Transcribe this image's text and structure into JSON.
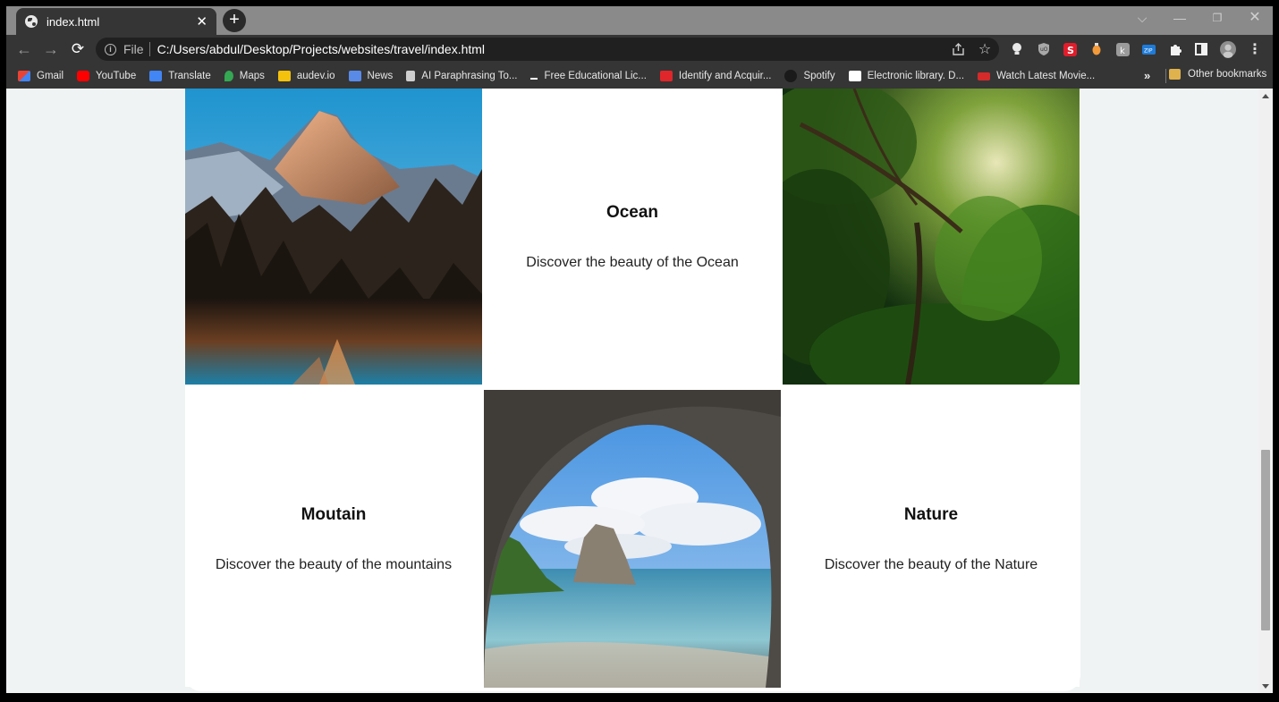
{
  "browser": {
    "tab_title": "index.html",
    "tab_close": "✕",
    "new_tab": "+",
    "window_controls": {
      "dropdown": "⌵",
      "minimize": "—",
      "restore": "❐",
      "close": "✕"
    },
    "nav": {
      "back": "←",
      "forward": "→",
      "reload": "⟳"
    },
    "address": {
      "scheme_label": "File",
      "url": "C:/Users/abdul/Desktop/Projects/websites/travel/index.html"
    },
    "bookmarks": [
      {
        "label": "Gmail",
        "color": "#ea4335"
      },
      {
        "label": "YouTube",
        "color": "#ff0000"
      },
      {
        "label": "Translate",
        "color": "#4285f4"
      },
      {
        "label": "Maps",
        "color": "#34a853"
      },
      {
        "label": "audev.io",
        "color": "#f4c20d"
      },
      {
        "label": "News",
        "color": "#5a8ae8"
      },
      {
        "label": "AI Paraphrasing To...",
        "color": "#cfcfcf"
      },
      {
        "label": "Free Educational Lic...",
        "color": "#ffffff"
      },
      {
        "label": "Identify and Acquir...",
        "color": "#e0262b"
      },
      {
        "label": "Spotify",
        "color": "#1a1a1a"
      },
      {
        "label": "Electronic library. D...",
        "color": "#ffffff"
      },
      {
        "label": "Watch Latest Movie...",
        "color": "#d42a2a"
      }
    ],
    "bookmarks_more": "»",
    "other_bookmarks": "Other bookmarks"
  },
  "page": {
    "cards": [
      {
        "title": "Ocean",
        "text": "Discover the beauty of the Ocean"
      },
      {
        "title": "Moutain",
        "text": "Discover the beauty of the mountains"
      },
      {
        "title": "Nature",
        "text": "Discover the beauty of the Nature"
      }
    ],
    "images": [
      "mountain-lake-photo",
      "forest-photo",
      "sea-cave-beach-photo"
    ]
  }
}
